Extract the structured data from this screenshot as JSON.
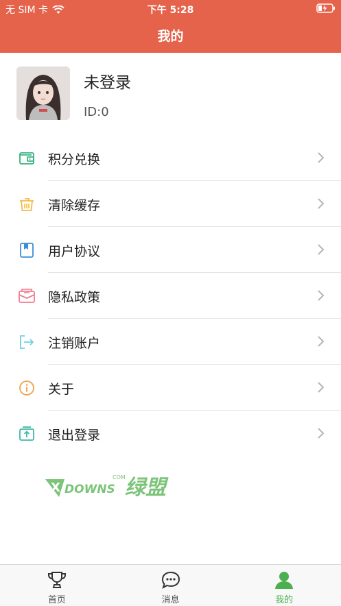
{
  "status_bar": {
    "carrier": "无 SIM 卡",
    "time": "下午 5:28"
  },
  "header": {
    "title": "我的"
  },
  "profile": {
    "name": "未登录",
    "id_text": "ID:0"
  },
  "menu": [
    {
      "label": "积分兑换",
      "icon": "wallet-icon",
      "color": "#36b37e"
    },
    {
      "label": "清除缓存",
      "icon": "trash-basket-icon",
      "color": "#f5b942"
    },
    {
      "label": "用户协议",
      "icon": "bookmark-doc-icon",
      "color": "#3b8fd4"
    },
    {
      "label": "隐私政策",
      "icon": "envelope-icon",
      "color": "#f07b8f"
    },
    {
      "label": "注销账户",
      "icon": "logout-arrow-icon",
      "color": "#6fd0e6"
    },
    {
      "label": "关于",
      "icon": "info-circle-icon",
      "color": "#f2a24a"
    },
    {
      "label": "退出登录",
      "icon": "exit-box-icon",
      "color": "#3fb6a8"
    }
  ],
  "watermark": {
    "text": "DOWNS",
    "sub": "绿盟",
    "tag": "COM"
  },
  "tabbar": [
    {
      "label": "首页",
      "icon": "trophy-icon"
    },
    {
      "label": "消息",
      "icon": "chat-bubble-icon"
    },
    {
      "label": "我的",
      "icon": "person-icon",
      "active": true
    }
  ],
  "colors": {
    "accent": "#e5624b",
    "active_tab": "#4caf50"
  }
}
